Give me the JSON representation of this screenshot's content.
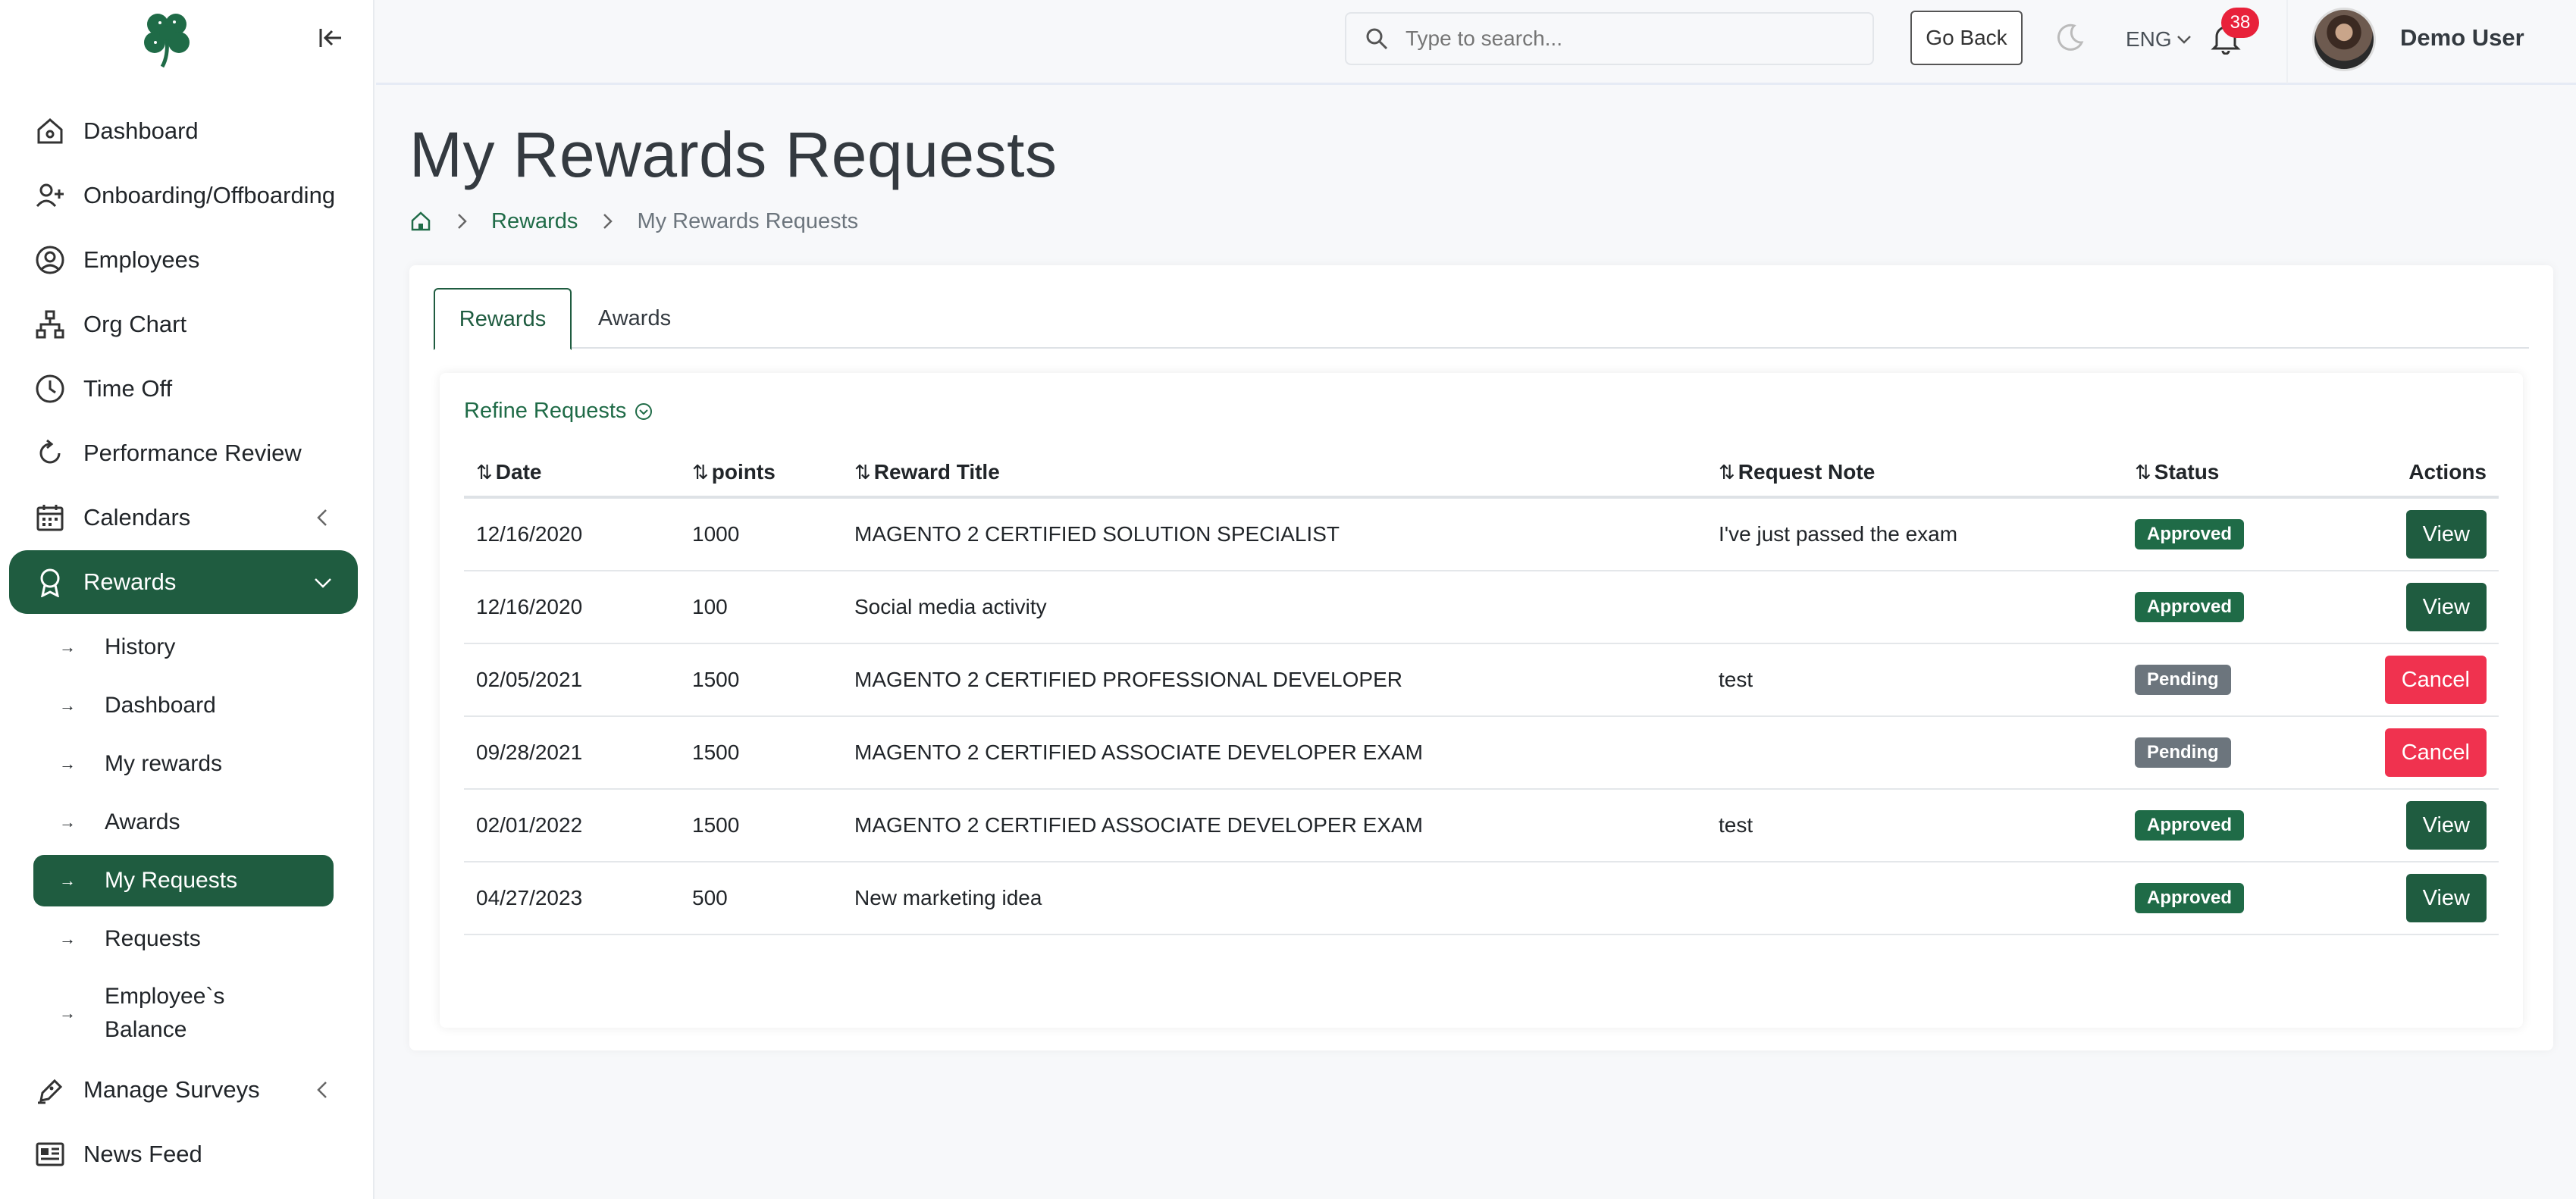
{
  "sidebar": {
    "logo_icon": "clover-logo-icon",
    "collapse_icon": "collapse-left-icon",
    "items": [
      {
        "label": "Dashboard",
        "icon": "home-icon"
      },
      {
        "label": "Onboarding/Offboarding",
        "icon": "user-plus-icon"
      },
      {
        "label": "Employees",
        "icon": "user-circle-icon"
      },
      {
        "label": "Org Chart",
        "icon": "org-chart-icon"
      },
      {
        "label": "Time Off",
        "icon": "clock-icon"
      },
      {
        "label": "Performance Review",
        "icon": "refresh-icon"
      },
      {
        "label": "Calendars",
        "icon": "calendar-icon"
      },
      {
        "label": "Rewards",
        "icon": "award-icon"
      },
      {
        "label": "Manage Surveys",
        "icon": "pen-icon"
      },
      {
        "label": "News Feed",
        "icon": "newspaper-icon"
      }
    ],
    "rewards_sub": [
      {
        "label": "History"
      },
      {
        "label": "Dashboard"
      },
      {
        "label": "My rewards"
      },
      {
        "label": "Awards"
      },
      {
        "label": "My Requests"
      },
      {
        "label": "Requests"
      },
      {
        "label": "Employee`s Balance"
      }
    ]
  },
  "header": {
    "search_placeholder": "Type to search...",
    "go_back": "Go Back",
    "language": "ENG",
    "notifications_count": "38",
    "user_name": "Demo User"
  },
  "page": {
    "title": "My Rewards Requests",
    "breadcrumb": {
      "parent": "Rewards",
      "current": "My Rewards Requests"
    }
  },
  "tabs": [
    "Rewards",
    "Awards"
  ],
  "filter": {
    "label": "Refine Requests"
  },
  "table": {
    "headers": {
      "date": "Date",
      "points": "points",
      "title": "Reward Title",
      "note": "Request Note",
      "status": "Status",
      "actions": "Actions"
    },
    "rows": [
      {
        "date": "12/16/2020",
        "points": "1000",
        "title": "MAGENTO 2 CERTIFIED SOLUTION SPECIALIST",
        "note": "I've just passed the exam",
        "status": "Approved",
        "action": "View"
      },
      {
        "date": "12/16/2020",
        "points": "100",
        "title": "Social media activity",
        "note": "",
        "status": "Approved",
        "action": "View"
      },
      {
        "date": "02/05/2021",
        "points": "1500",
        "title": "MAGENTO 2 CERTIFIED PROFESSIONAL DEVELOPER",
        "note": "test",
        "status": "Pending",
        "action": "Cancel"
      },
      {
        "date": "09/28/2021",
        "points": "1500",
        "title": "MAGENTO 2 CERTIFIED ASSOCIATE DEVELOPER EXAM",
        "note": "",
        "status": "Pending",
        "action": "Cancel"
      },
      {
        "date": "02/01/2022",
        "points": "1500",
        "title": "MAGENTO 2 CERTIFIED ASSOCIATE DEVELOPER EXAM",
        "note": "test",
        "status": "Approved",
        "action": "View"
      },
      {
        "date": "04/27/2023",
        "points": "500",
        "title": "New marketing idea",
        "note": "",
        "status": "Approved",
        "action": "View"
      }
    ]
  },
  "colors": {
    "brand": "#1f5c40",
    "danger": "#f0324f",
    "pending": "#6c757d"
  }
}
